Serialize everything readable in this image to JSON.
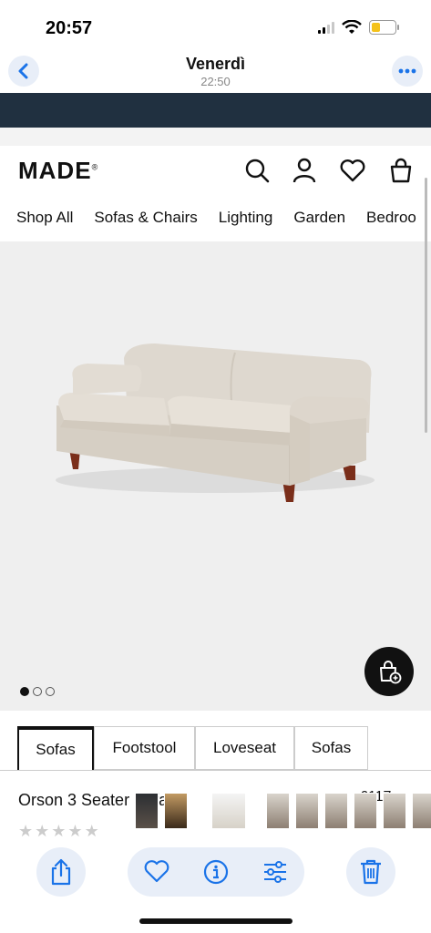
{
  "status": {
    "time": "20:57"
  },
  "photos_nav": {
    "title": "Venerdì",
    "subtitle": "22:50"
  },
  "site": {
    "logo": "MADE",
    "logo_mark": "®",
    "nav": [
      "Shop All",
      "Sofas & Chairs",
      "Lighting",
      "Garden",
      "Bedroo"
    ],
    "carousel": {
      "total": 3,
      "current": 1
    },
    "tabs": [
      "Sofas",
      "Footstool",
      "Loveseat",
      "Sofas"
    ],
    "active_tab": 0,
    "product": {
      "name": "Orson 3 Seater Sofa",
      "price": "£117",
      "rating": 0,
      "max_rating": 5
    }
  },
  "colors": {
    "accent": "#1a73e8",
    "banner": "#203040",
    "product_bg": "#efefef"
  }
}
